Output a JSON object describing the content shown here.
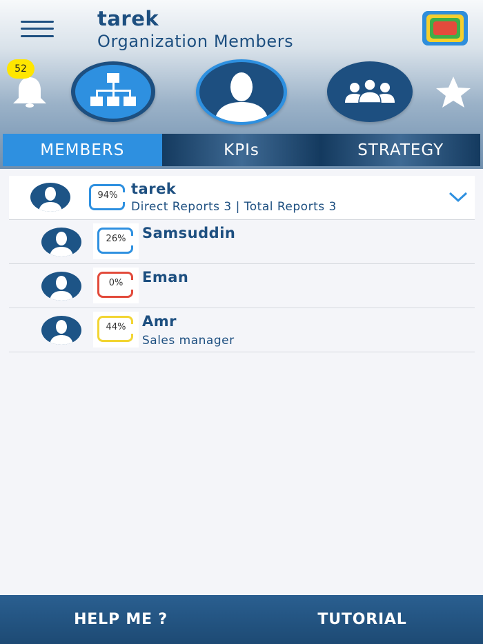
{
  "header": {
    "title": "tarek",
    "subtitle": "Organization Members",
    "menu_icon": "hamburger-menu-icon",
    "logo_icon": "app-logo-icon"
  },
  "notifications": {
    "count": "52"
  },
  "nav_buttons": [
    {
      "name": "org-chart-button",
      "icon": "org-chart-icon"
    },
    {
      "name": "profile-button",
      "icon": "user-icon"
    },
    {
      "name": "team-button",
      "icon": "team-icon"
    },
    {
      "name": "favorites-button",
      "icon": "star-icon"
    }
  ],
  "tabs": [
    {
      "label": "MEMBERS",
      "active": true
    },
    {
      "label": "KPIs",
      "active": false
    },
    {
      "label": "STRATEGY",
      "active": false
    }
  ],
  "members": {
    "head": {
      "name": "tarek",
      "kpi": "94%",
      "kpi_color": "#2e90e0",
      "detail": "Direct Reports 3 | Total Reports 3"
    },
    "reports": [
      {
        "name": "Samsuddin",
        "kpi": "26%",
        "kpi_color": "#2e90e0",
        "detail": ""
      },
      {
        "name": "Eman",
        "kpi": "0%",
        "kpi_color": "#e24a3b",
        "detail": ""
      },
      {
        "name": "Amr",
        "kpi": "44%",
        "kpi_color": "#f2d533",
        "detail": "Sales manager"
      }
    ]
  },
  "footer": {
    "help_label": "HELP ME ?",
    "tutorial_label": "TUTORIAL"
  },
  "colors": {
    "primary": "#1d4f80",
    "accent": "#2e90e0",
    "badge": "#ffe600"
  }
}
